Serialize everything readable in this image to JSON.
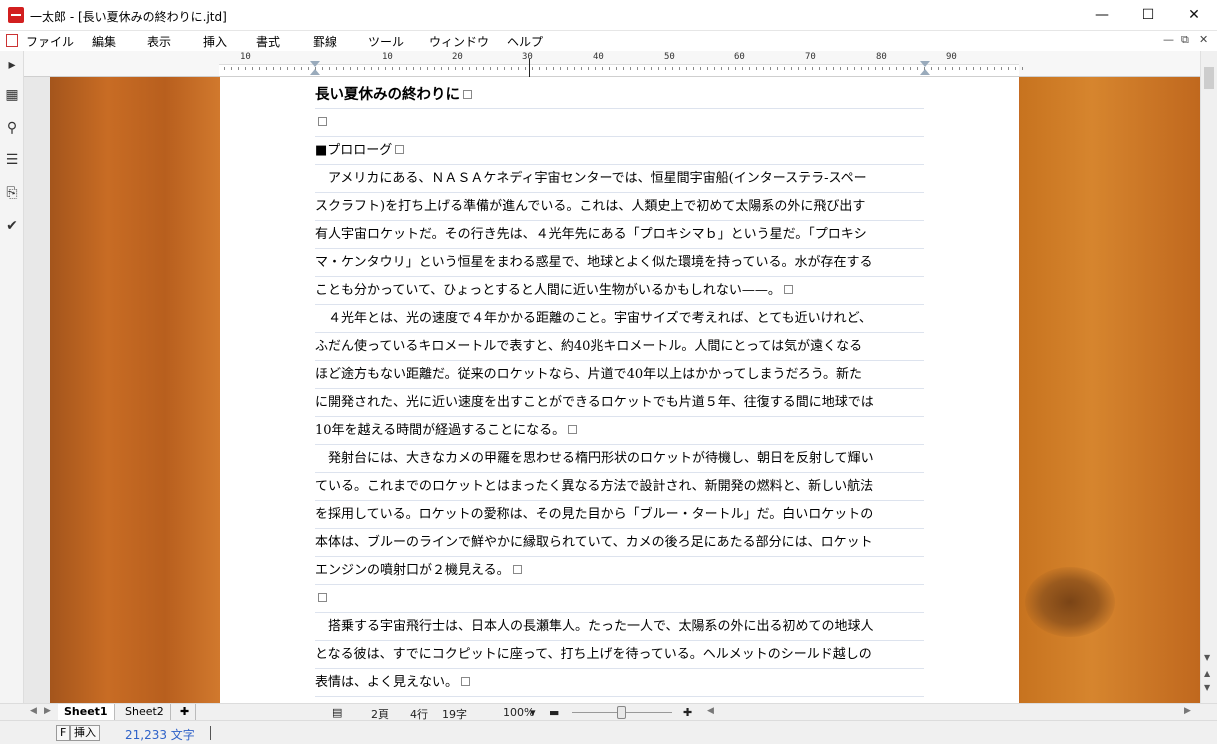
{
  "window": {
    "title": "一太郎 - [長い夏休みの終わりに.jtd]",
    "minimize": "—",
    "maximize": "☐",
    "close": "✕"
  },
  "menu": [
    "ファイル",
    "編集",
    "表示",
    "挿入",
    "書式",
    "罫線",
    "ツール",
    "ウィンドウ",
    "ヘルプ"
  ],
  "mdi_controls": [
    "—",
    "⧉",
    "✕"
  ],
  "left_toolbar": [
    {
      "icon": "play-arrow-icon",
      "glyph": "▸"
    },
    {
      "icon": "grid-view-icon",
      "glyph": "▦"
    },
    {
      "icon": "search-icon",
      "glyph": "⚲"
    },
    {
      "icon": "list-icon",
      "glyph": "☰"
    },
    {
      "icon": "clipboard-icon",
      "glyph": "⎘"
    },
    {
      "icon": "check-icon",
      "glyph": "✔"
    }
  ],
  "ruler": {
    "numbers": [
      "10",
      "10",
      "20",
      "30",
      "40",
      "50",
      "60",
      "70",
      "80",
      "90"
    ]
  },
  "document": {
    "lines": [
      "長い夏休みの終わりに",
      "",
      "■プロローグ",
      "　アメリカにある、ＮＡＳＡケネディ宇宙センターでは、恒星間宇宙船(インターステラ-スペー",
      "スクラフト)を打ち上げる準備が進んでいる。これは、人類史上で初めて太陽系の外に飛び出す",
      "有人宇宙ロケットだ。その行き先は、４光年先にある「プロキシマｂ」という星だ。「プロキシ",
      "マ・ケンタウリ」という恒星をまわる惑星で、地球とよく似た環境を持っている。水が存在する",
      "ことも分かっていて、ひょっとすると人間に近い生物がいるかもしれない——。",
      "　４光年とは、光の速度で４年かかる距離のこと。宇宙サイズで考えれば、とても近いけれど、",
      "ふだん使っているキロメートルで表すと、約40兆キロメートル。人間にとっては気が遠くなる",
      "ほど途方もない距離だ。従来のロケットなら、片道で40年以上はかかってしまうだろう。新た",
      "に開発された、光に近い速度を出すことができるロケットでも片道５年、往復する間に地球では",
      "10年を越える時間が経過することになる。",
      "　発射台には、大きなカメの甲羅を思わせる楕円形状のロケットが待機し、朝日を反射して輝い",
      "ている。これまでのロケットとはまったく異なる方法で設計され、新開発の燃料と、新しい航法",
      "を採用している。ロケットの愛称は、その見た目から「ブルー・タートル」だ。白いロケットの",
      "本体は、ブルーのラインで鮮やかに縁取られていて、カメの後ろ足にあたる部分には、ロケット",
      "エンジンの噴射口が２機見える。",
      "",
      "　搭乗する宇宙飛行士は、日本人の長瀬隼人。たった一人で、太陽系の外に出る初めての地球人",
      "となる彼は、すでにコクピットに座って、打ち上げを待っている。ヘルメットのシールド越しの",
      "表情は、よく見えない。"
    ],
    "paragraph_end_lines": [
      0,
      1,
      2,
      7,
      12,
      17,
      18,
      21
    ]
  },
  "sheets": {
    "tabs": [
      "Sheet1",
      "Sheet2"
    ],
    "active": "Sheet1",
    "add": "✚"
  },
  "page_status": {
    "page": "2頁",
    "line": "4行",
    "column": "19字",
    "zoom": "100%",
    "zoom_level": 0.45
  },
  "status": {
    "f_key": "F",
    "mode": "挿入",
    "char_count": "21,233 文字"
  }
}
